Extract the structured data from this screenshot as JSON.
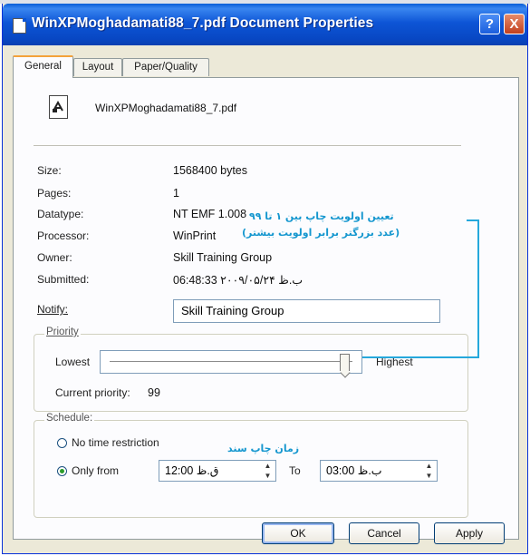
{
  "window": {
    "title": "WinXPMoghadamati88_7.pdf Document Properties",
    "help_button": "?",
    "close_button": "X"
  },
  "tabs": [
    {
      "label": "General",
      "active": true
    },
    {
      "label": "Layout",
      "active": false
    },
    {
      "label": "Paper/Quality",
      "active": false
    }
  ],
  "document": {
    "name": "WinXPMoghadamati88_7.pdf"
  },
  "properties": {
    "size_label": "Size:",
    "size_value": "1568400 bytes",
    "pages_label": "Pages:",
    "pages_value": "1",
    "datatype_label": "Datatype:",
    "datatype_value": "NT EMF 1.008",
    "processor_label": "Processor:",
    "processor_value": "WinPrint",
    "owner_label": "Owner:",
    "owner_value": "Skill Training Group",
    "submitted_label": "Submitted:",
    "submitted_value": "06:48:33 ۲۰۰۹/۰۵/۲۴ ب.ظ",
    "notify_label": "Notify:",
    "notify_value": "Skill Training Group"
  },
  "priority": {
    "group_label": "Priority",
    "lowest_label": "Lowest",
    "highest_label": "Highest",
    "current_label": "Current priority:",
    "current_value": "99",
    "slider_level": 0.99
  },
  "schedule": {
    "group_label": "Schedule:",
    "no_time_label": "No time restriction",
    "only_from_label": "Only from",
    "selected": "only_from",
    "from_value": "12:00 ق.ظ",
    "to_label": "To",
    "to_value": "03:00 ب.ظ"
  },
  "buttons": {
    "ok": "OK",
    "cancel": "Cancel",
    "apply": "Apply"
  },
  "annotations": {
    "note1_line1": "تعیین اولویت چاپ بین ۱ تا ۹۹",
    "note1_line2": "(عدد بزرگتر برابر اولویت بیشتر)",
    "note2": "زمان چاپ سند",
    "color": "#1597cf"
  },
  "colors": {
    "titlebar": "#0a55d4",
    "dialog_bg": "#ece9d8",
    "tab_active_accent": "#f3a23a",
    "close_button": "#c2401e"
  }
}
